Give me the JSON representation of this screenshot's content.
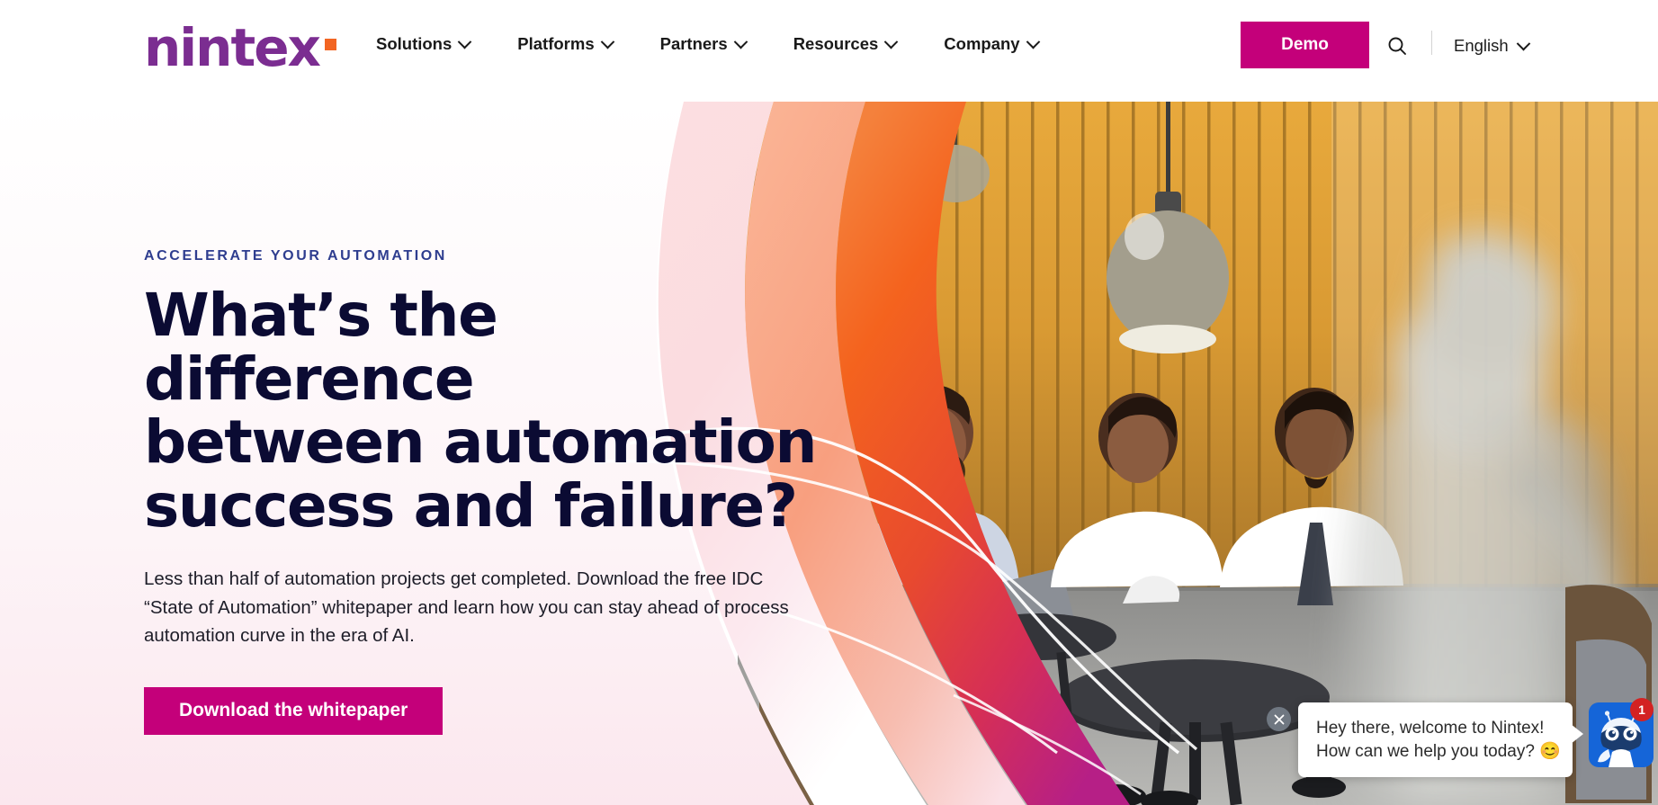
{
  "header": {
    "logo_text": "nintex",
    "logo_color": "#7B2D91",
    "logo_dot_color": "#F26522",
    "nav": [
      {
        "label": "Solutions",
        "icon": "chevron-down-icon"
      },
      {
        "label": "Platforms",
        "icon": "chevron-down-icon"
      },
      {
        "label": "Partners",
        "icon": "chevron-down-icon"
      },
      {
        "label": "Resources",
        "icon": "chevron-down-icon"
      },
      {
        "label": "Company",
        "icon": "chevron-down-icon"
      }
    ],
    "demo_label": "Demo",
    "demo_color": "#C4007A",
    "search_icon": "search-icon",
    "language": {
      "label": "English",
      "icon": "chevron-down-icon"
    }
  },
  "hero": {
    "eyebrow": "ACCELERATE YOUR AUTOMATION",
    "eyebrow_color": "#2E3D8F",
    "headline_line1": "What’s the difference",
    "headline_line2": "between automation",
    "headline_line3": "success and failure?",
    "headline_color": "#0B0B33",
    "subcopy": "Less than half of automation projects get completed. Download the free IDC “State of Automation” whitepaper and learn how you can stay ahead of process automation curve in the era of AI.",
    "cta_label": "Download the whitepaper",
    "cta_color": "#C4007A",
    "image_description": "Office meeting: four colleagues seated by a wooden slat wall with pendant lamps, one person walking past in motion blur",
    "overlay_colors": {
      "pale_pink": "#FBE3E6",
      "salmon": "#F9A184",
      "orange": "#F4631E",
      "red": "#E0413C",
      "magenta": "#C2247E"
    }
  },
  "chat": {
    "close_icon": "close-icon",
    "message_line1": "Hey there, welcome to Nintex!",
    "message_line2": "How can we help you today? 😊",
    "avatar_icon": "chat-robot-icon",
    "avatar_color": "#1565D8",
    "badge_count": "1",
    "badge_color": "#D32222"
  }
}
